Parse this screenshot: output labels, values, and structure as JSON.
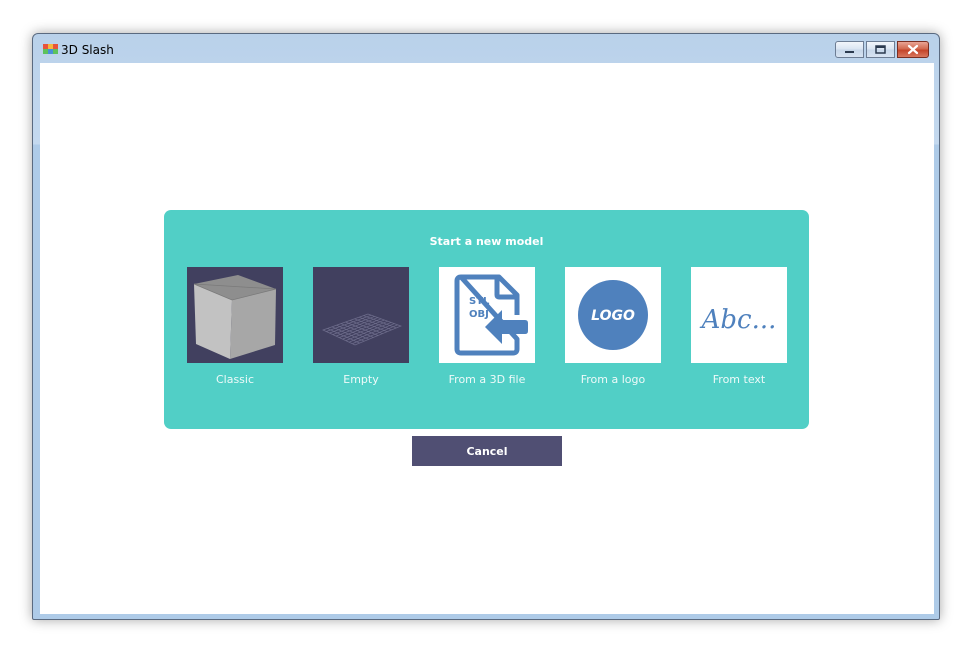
{
  "window": {
    "title": "3D Slash"
  },
  "dialog": {
    "title": "Start a new model",
    "options": [
      {
        "label": "Classic",
        "icon": "cube-icon"
      },
      {
        "label": "Empty",
        "icon": "grid-plane-icon"
      },
      {
        "label": "From a 3D file",
        "icon": "file-import-icon",
        "file_types": [
          "STL",
          "OBJ"
        ]
      },
      {
        "label": "From a logo",
        "icon": "logo-icon",
        "logo_text": "LOGO"
      },
      {
        "label": "From text",
        "icon": "text-icon",
        "sample_text": "Abc..."
      }
    ],
    "cancel_label": "Cancel"
  },
  "colors": {
    "panel": "#51cfc6",
    "dark_thumb": "#41405f",
    "icon_blue": "#4f81bd",
    "cancel_button": "#504f73"
  }
}
